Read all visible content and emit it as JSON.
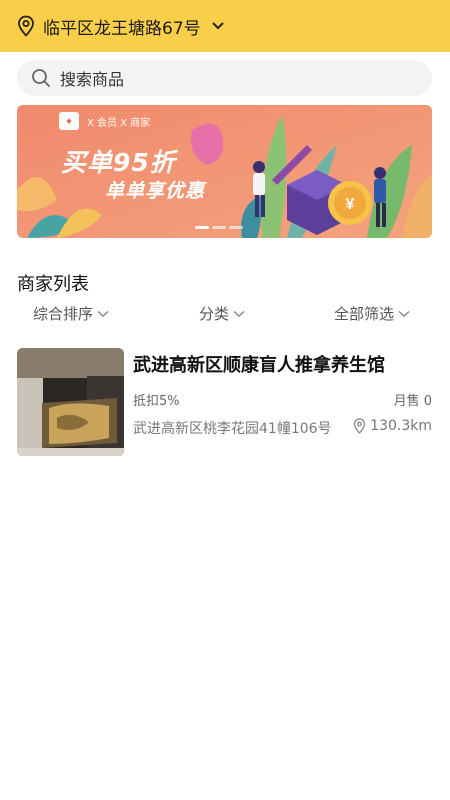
{
  "header": {
    "location": "临平区龙王塘路67号",
    "icons": {
      "location": "location-pin-icon",
      "dropdown": "chevron-down-icon"
    },
    "bg_color": "#f9cf4a"
  },
  "search": {
    "placeholder": "搜索商品",
    "icon": "search-icon"
  },
  "banner": {
    "logo_text": "X 会员  X 商家",
    "title": "买单95折",
    "subtitle": "单单享优惠",
    "slides": 3,
    "active_slide": 1
  },
  "merchants": {
    "title": "商家列表",
    "filters": [
      {
        "label": "综合排序"
      },
      {
        "label": "分类"
      },
      {
        "label": "全部筛选"
      }
    ],
    "items": [
      {
        "name": "武进高新区顺康盲人推拿养生馆",
        "discount": "抵扣5%",
        "sales": "月售 0",
        "address": "武进高新区桃李花园41幢106号",
        "distance": "130.3km"
      }
    ]
  }
}
